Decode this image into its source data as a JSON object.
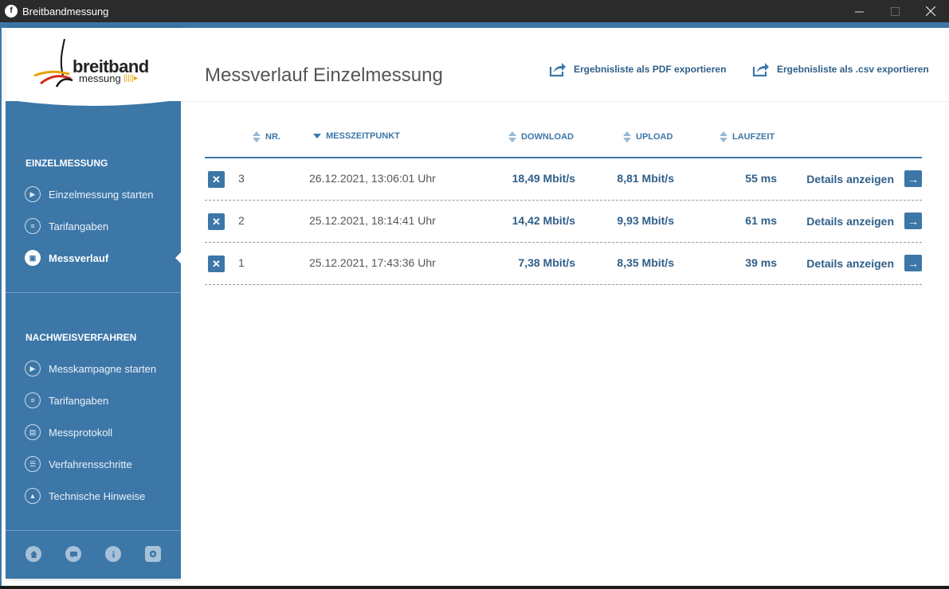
{
  "window": {
    "title": "Breitbandmessung",
    "app_icon": "f"
  },
  "logo": {
    "line1": "breitband",
    "line2": "messung"
  },
  "sidebar": {
    "section1_heading": "EINZELMESSUNG",
    "section1_items": [
      {
        "label": "Einzelmessung starten",
        "icon": "play-icon",
        "glyph": "▶"
      },
      {
        "label": "Tarifangaben",
        "icon": "person-card-icon",
        "glyph": "≡"
      },
      {
        "label": "Messverlauf",
        "icon": "history-icon",
        "glyph": "▣",
        "active": true
      }
    ],
    "section2_heading": "NACHWEISVERFAHREN",
    "section2_items": [
      {
        "label": "Messkampagne starten",
        "icon": "play-icon",
        "glyph": "▶"
      },
      {
        "label": "Tarifangaben",
        "icon": "person-card-icon",
        "glyph": "≡"
      },
      {
        "label": "Messprotokoll",
        "icon": "document-icon",
        "glyph": "▤"
      },
      {
        "label": "Verfahrensschritte",
        "icon": "list-icon",
        "glyph": "☰"
      },
      {
        "label": "Technische Hinweise",
        "icon": "warning-icon",
        "glyph": "▲"
      }
    ],
    "footer_icons": [
      "home-icon",
      "chat-icon",
      "info-icon",
      "settings-icon"
    ]
  },
  "main": {
    "title": "Messverlauf Einzelmessung",
    "export_pdf": "Ergebnisliste als PDF exportieren",
    "export_csv": "Ergebnisliste als .csv exportieren",
    "columns": {
      "nr": "NR.",
      "time": "MESSZEITPUNKT",
      "download": "DOWNLOAD",
      "upload": "UPLOAD",
      "latency": "LAUFZEIT"
    },
    "rows": [
      {
        "nr": "3",
        "time": "26.12.2021, 13:06:01 Uhr",
        "download": "18,49 Mbit/s",
        "upload": "8,81 Mbit/s",
        "latency": "55 ms",
        "details": "Details anzeigen"
      },
      {
        "nr": "2",
        "time": "25.12.2021, 18:14:41 Uhr",
        "download": "14,42 Mbit/s",
        "upload": "9,93 Mbit/s",
        "latency": "61 ms",
        "details": "Details anzeigen"
      },
      {
        "nr": "1",
        "time": "25.12.2021, 17:43:36 Uhr",
        "download": "7,38 Mbit/s",
        "upload": "8,35 Mbit/s",
        "latency": "39 ms",
        "details": "Details anzeigen"
      }
    ]
  },
  "colors": {
    "accent": "#3c77a8",
    "text_dark": "#2f5f88",
    "muted": "#555555"
  }
}
